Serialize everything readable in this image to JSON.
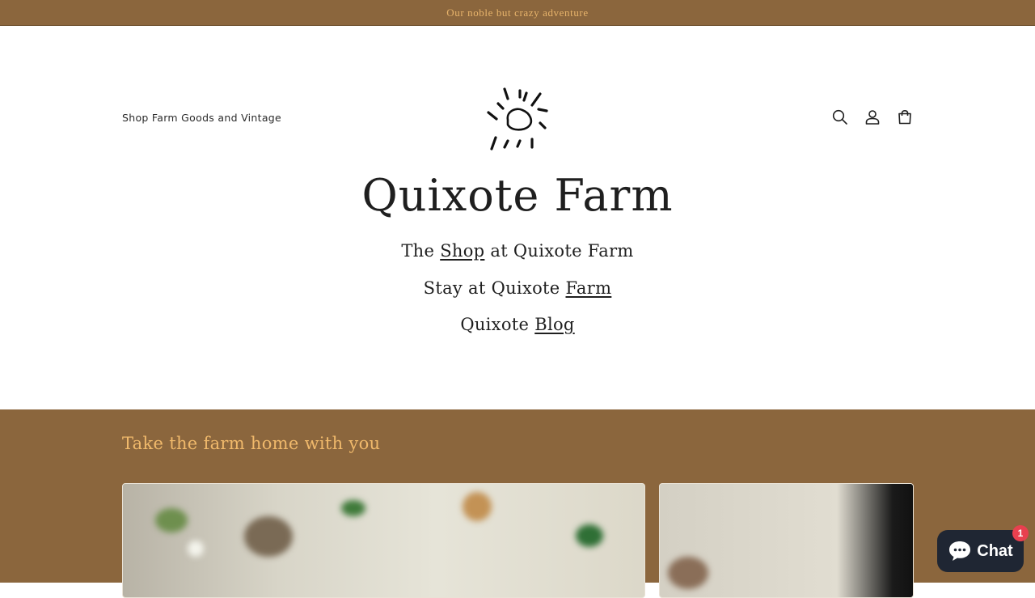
{
  "announcement": {
    "text": "Our noble but crazy adventure"
  },
  "header": {
    "nav_link": "Shop Farm Goods and Vintage",
    "icons": [
      "search-icon",
      "account-icon",
      "cart-icon"
    ]
  },
  "hero": {
    "title": "Quixote Farm",
    "line1": {
      "prefix": "The ",
      "link": "Shop",
      "suffix": " at Quixote Farm"
    },
    "line2": {
      "prefix": "Stay at Quixote ",
      "link": "Farm"
    },
    "line3": {
      "prefix": "Quixote ",
      "link": "Blog"
    }
  },
  "featured": {
    "heading": "Take the farm home with you"
  },
  "chat": {
    "label": "Chat",
    "badge": "1"
  },
  "colors": {
    "brown": "#8b663d",
    "accent": "#f0b96b",
    "chat_bg": "#1f2633",
    "badge": "#e8404f"
  }
}
